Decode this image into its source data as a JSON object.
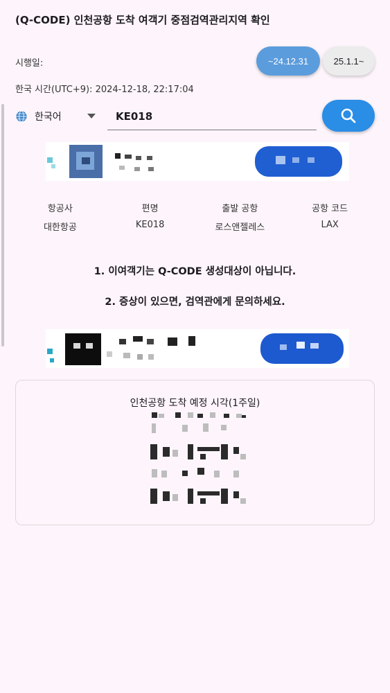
{
  "header": {
    "title": "(Q-CODE) 인천공항 도착 여객기 중점검역관리지역 확인"
  },
  "effective": {
    "label": "시행일:",
    "options": [
      "~24.12.31",
      "25.1.1~"
    ],
    "selected": "~24.12.31"
  },
  "clock": {
    "text": "한국 시간(UTC+9): 2024-12-18, 22:17:04"
  },
  "search": {
    "language": "한국어",
    "flight_value": "KE018"
  },
  "flight_info": {
    "headers": [
      "항공사",
      "편명",
      "출발 공항",
      "공항 코드"
    ],
    "values": [
      "대한항공",
      "KE018",
      "로스앤젤레스",
      "LAX"
    ]
  },
  "notices": [
    "1. 이여객기는 Q-CODE 생성대상이 아닙니다.",
    "2. 증상이 있으면, 검역관에게 문의하세요."
  ],
  "arrival_card": {
    "title": "인천공항 도착 예정 시각(1주일)"
  },
  "colors": {
    "accent": "#2a8de6",
    "selected_chip": "#5b9cdc",
    "background": "#fdf5fb"
  }
}
